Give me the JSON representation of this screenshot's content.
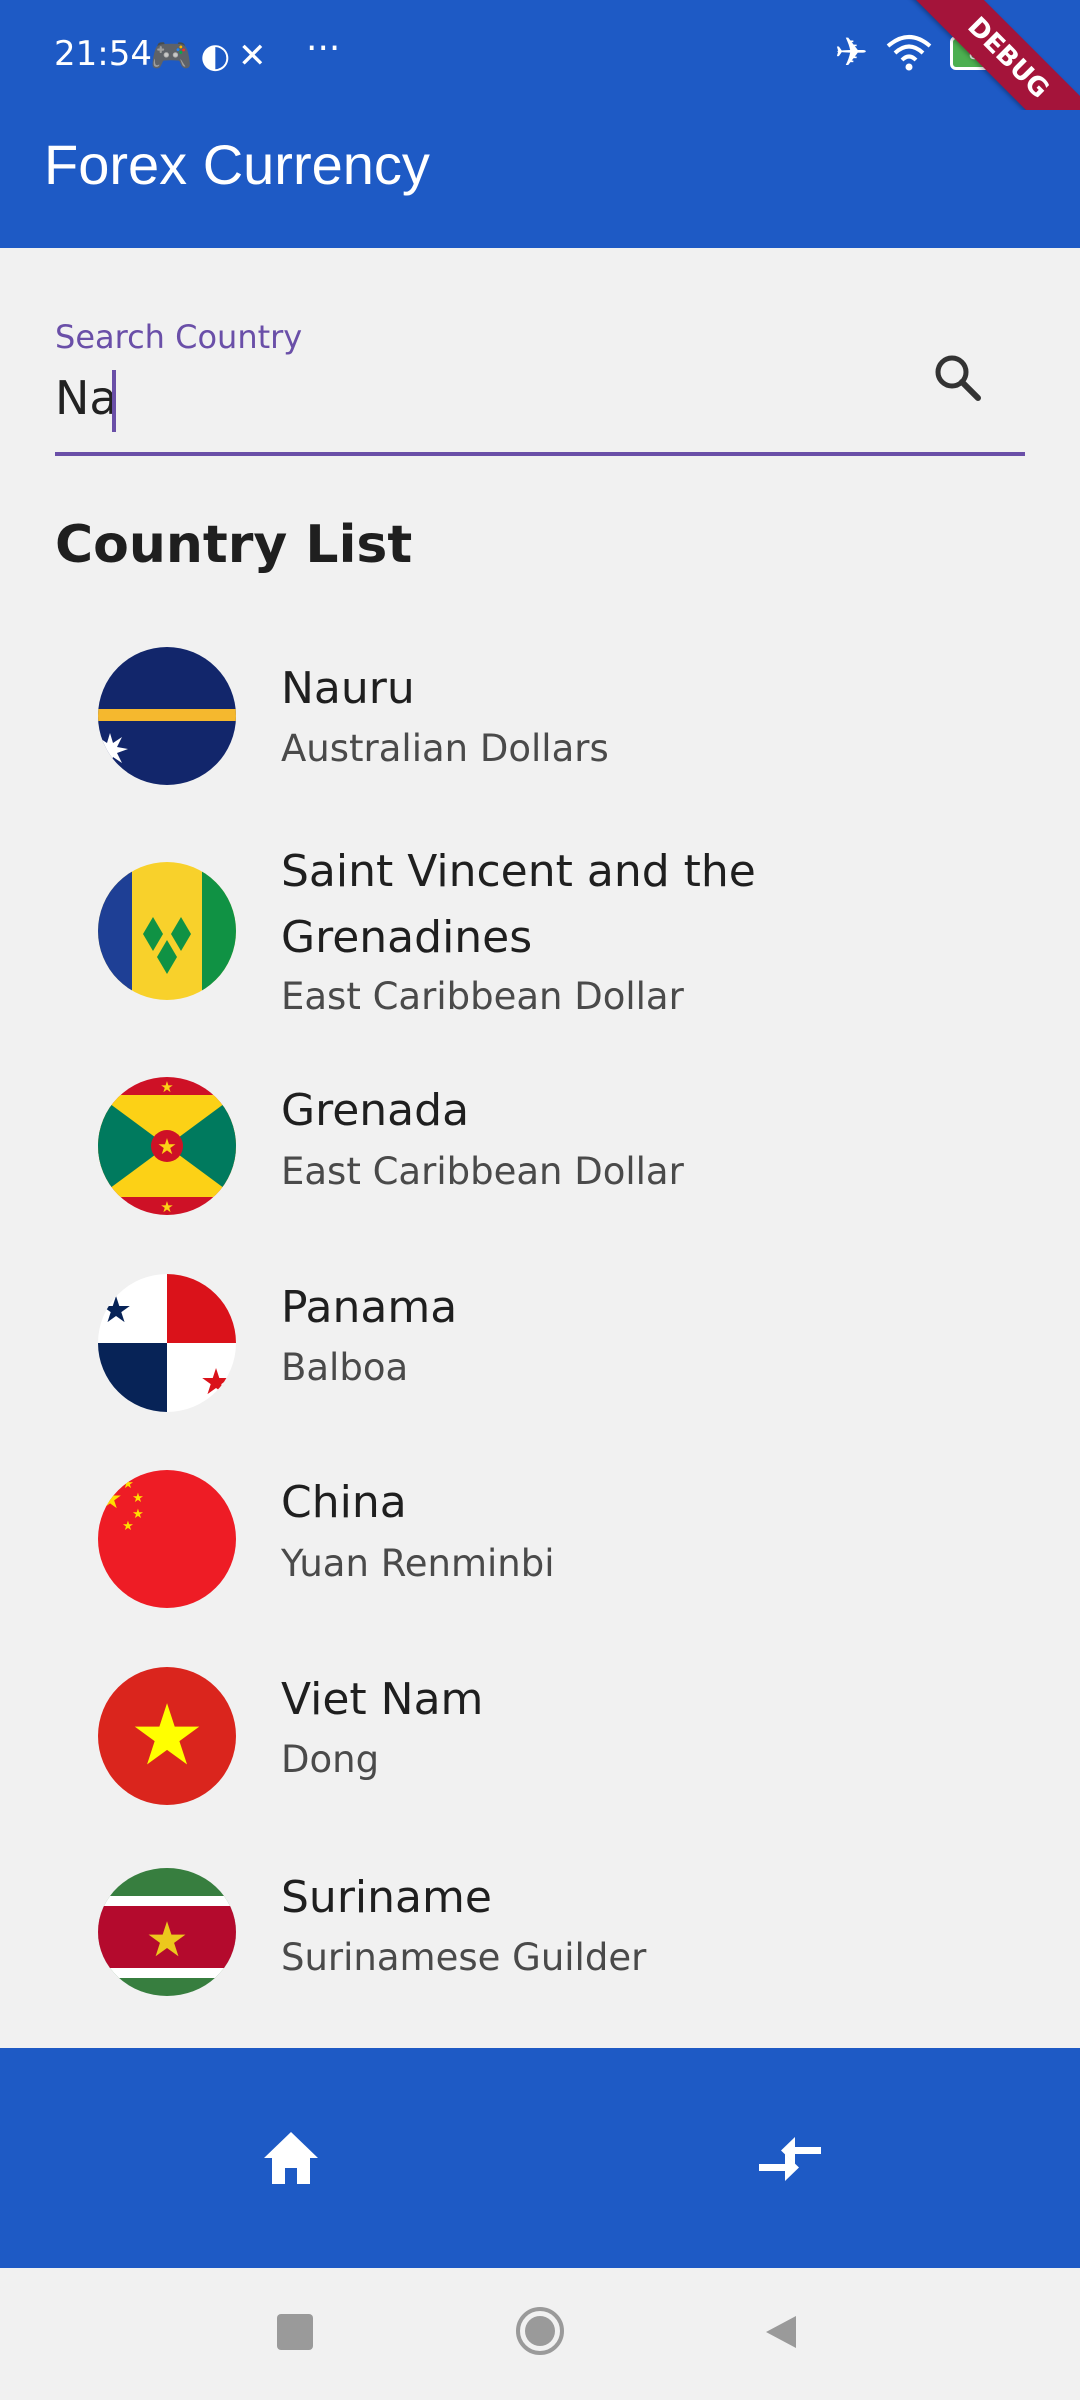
{
  "status_bar": {
    "time": "21:54",
    "more": "···",
    "battery": "80",
    "debug_banner": "DEBUG"
  },
  "app_bar": {
    "title": "Forex Currency"
  },
  "search": {
    "label": "Search Country",
    "value": "Na"
  },
  "list_title": "Country List",
  "countries": [
    {
      "name": "Nauru",
      "currency": "Australian Dollars"
    },
    {
      "name": "Saint Vincent and the Grenadines",
      "currency": "East Caribbean Dollar"
    },
    {
      "name": "Grenada",
      "currency": "East Caribbean Dollar"
    },
    {
      "name": "Panama",
      "currency": "Balboa"
    },
    {
      "name": "China",
      "currency": "Yuan Renminbi"
    },
    {
      "name": "Viet Nam",
      "currency": "Dong"
    },
    {
      "name": "Suriname",
      "currency": "Surinamese Guilder"
    }
  ],
  "bottom_nav": {
    "items": [
      {
        "icon": "home-icon"
      },
      {
        "icon": "compare-arrows-icon"
      }
    ]
  },
  "colors": {
    "primary": "#1e5ac5",
    "accent": "#6a4fa8",
    "background": "#f1f1f1"
  }
}
